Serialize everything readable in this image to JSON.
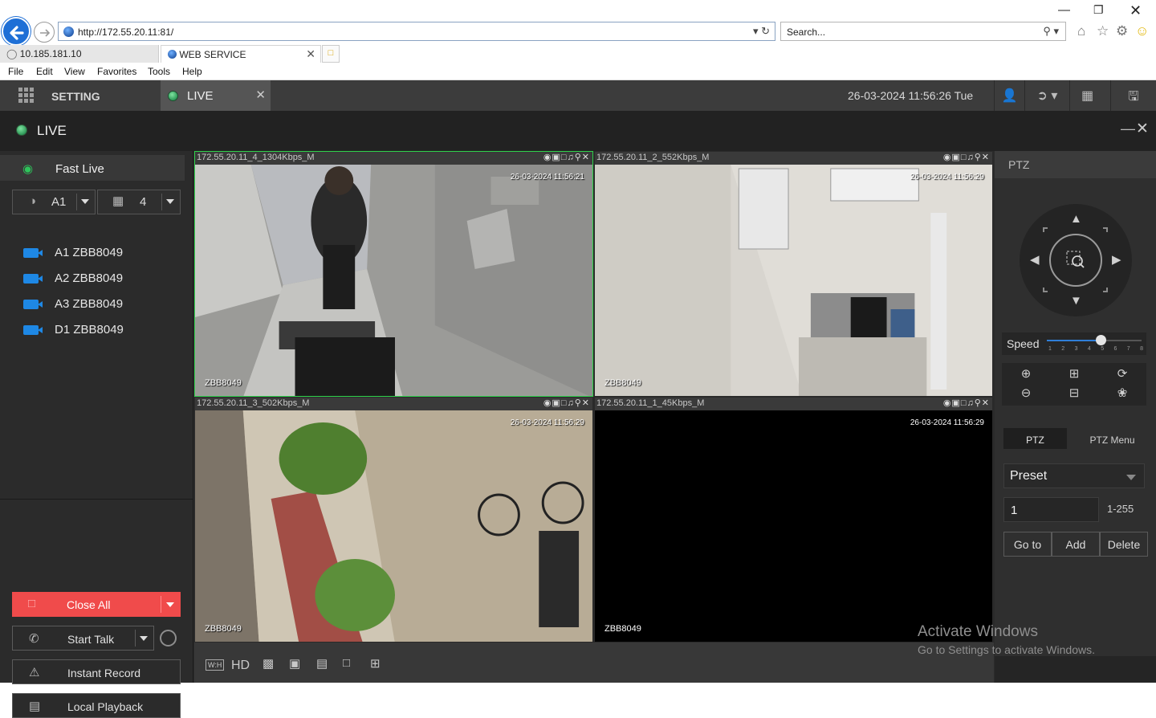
{
  "browser": {
    "url": "http://172.55.20.11:81/",
    "search_placeholder": "Search...",
    "tabs": [
      {
        "label": "10.185.181.10"
      },
      {
        "label": "WEB SERVICE"
      }
    ],
    "menu": [
      "File",
      "Edit",
      "View",
      "Favorites",
      "Tools",
      "Help"
    ]
  },
  "topnav": {
    "setting_label": "SETTING",
    "live_tab_label": "LIVE",
    "datetime": "26-03-2024 11:56:26 Tue"
  },
  "titlebar": {
    "title": "LIVE"
  },
  "left": {
    "fast_live": "Fast Live",
    "channel_group": "A1",
    "layout_count": "4",
    "channels": [
      {
        "label": "A1 ZBB8049"
      },
      {
        "label": "A2 ZBB8049"
      },
      {
        "label": "A3 ZBB8049"
      },
      {
        "label": "D1 ZBB8049"
      }
    ],
    "close_all": "Close All",
    "start_talk": "Start Talk",
    "instant_record": "Instant Record",
    "local_playback": "Local Playback"
  },
  "videos": [
    {
      "title": "172.55.20.11_4_1304Kbps_M",
      "timestamp": "26-03-2024 11:56:21",
      "name": "ZBB8049",
      "selected": true
    },
    {
      "title": "172.55.20.11_2_552Kbps_M",
      "timestamp": "26-03-2024 11:56:29",
      "name": "ZBB8049",
      "selected": false
    },
    {
      "title": "172.55.20.11_3_502Kbps_M",
      "timestamp": "26-03-2024 11:56:29",
      "name": "ZBB8049",
      "selected": false
    },
    {
      "title": "172.55.20.11_1_45Kbps_M",
      "timestamp": "26-03-2024 11:56:29",
      "name": "ZBB8049",
      "selected": false
    }
  ],
  "video_toolbar": {
    "wh": "W:H",
    "hd": "HD"
  },
  "ptz": {
    "header": "PTZ",
    "speed_label": "Speed",
    "speed_ticks": [
      "1",
      "2",
      "3",
      "4",
      "5",
      "6",
      "7",
      "8"
    ],
    "speed_value": 5,
    "speed_max": 8,
    "tab_ptz": "PTZ",
    "tab_ptz_menu": "PTZ Menu",
    "preset_select": "Preset",
    "preset_number": "1",
    "preset_range": "1-255",
    "goto": "Go to",
    "add": "Add",
    "delete": "Delete"
  },
  "watermark": {
    "line1": "Activate Windows",
    "line2": "Go to Settings to activate Windows."
  },
  "colors": {
    "accent_red": "#f04b4b",
    "live_green": "#2fd14b",
    "channel_blue": "#1e88e5"
  }
}
